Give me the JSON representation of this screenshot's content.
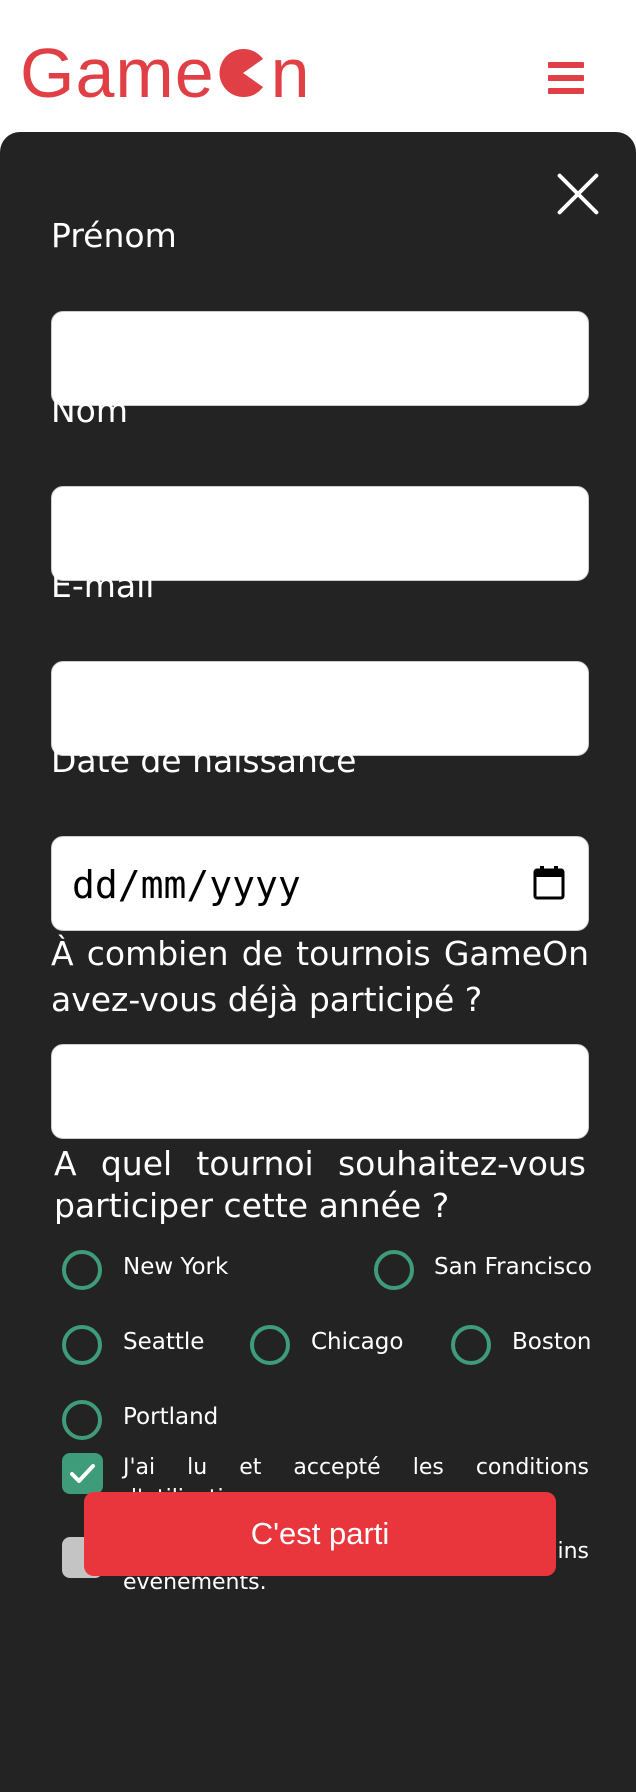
{
  "brand": {
    "logo_part1": "Game",
    "logo_part2": "n",
    "accent": "#e03f45"
  },
  "modal": {
    "first_name_label": "Prénom",
    "last_name_label": "Nom",
    "email_label": "E-mail",
    "birthdate_label": "Date de naissance",
    "birthdate_placeholder": "dd/mm/yyyy",
    "quantity_label": "À combien de tournois GameOn avez-vous déjà participé ?",
    "location_label": "A quel tournoi souhaitez-vous participer cette année ?",
    "locations": [
      "New York",
      "San Francisco",
      "Seattle",
      "Chicago",
      "Boston",
      "Portland"
    ],
    "terms_label": "J'ai lu et accepté les conditions d'utilisation.",
    "terms_checked": true,
    "newsletter_label": "Je Je souhaite être prévenu des prochains évènements.",
    "newsletter_checked": false,
    "submit_label": "C'est parti"
  },
  "colors": {
    "modal_bg": "#232323",
    "radio": "#3e9c7a",
    "button": "#e8363c"
  },
  "icons": [
    "menu-icon",
    "close-icon",
    "calendar-icon",
    "checkmark-icon"
  ]
}
